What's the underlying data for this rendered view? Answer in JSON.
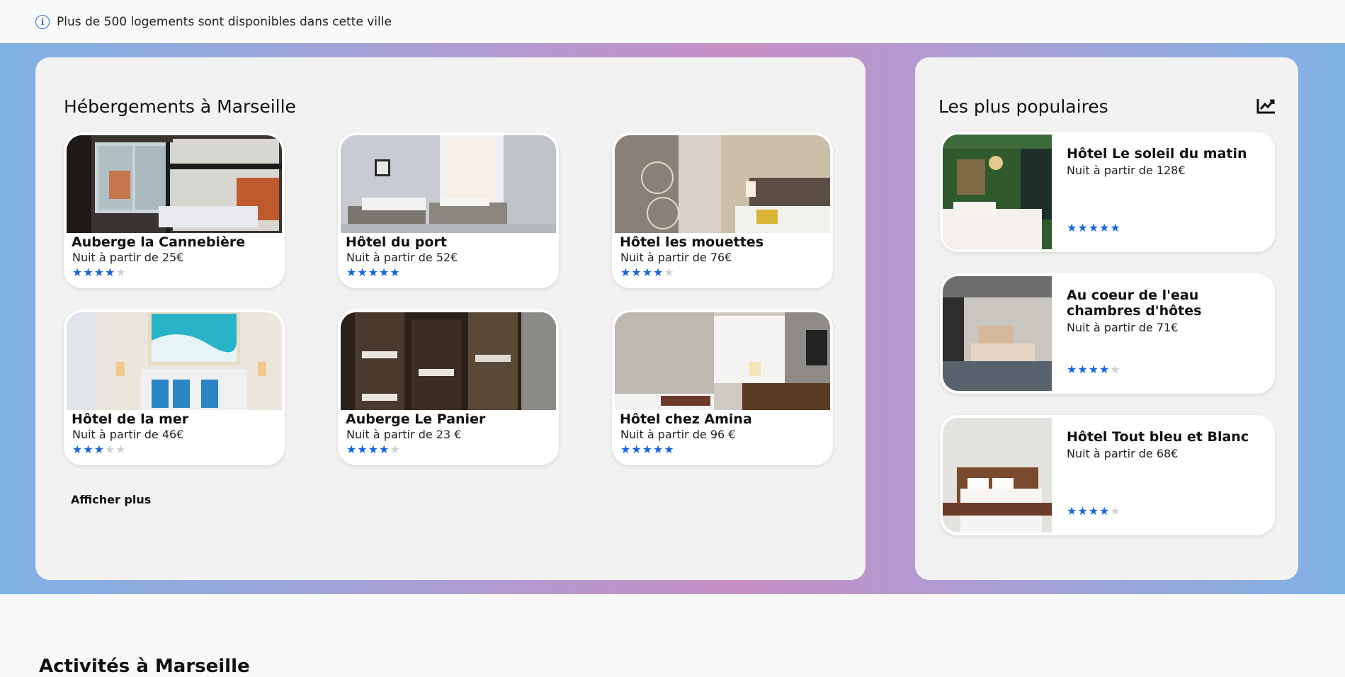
{
  "info": {
    "icon": "info-icon",
    "text": "Plus de 500 logements sont disponibles dans cette ville"
  },
  "main": {
    "title": "Hébergements à Marseille",
    "show_more": "Afficher plus",
    "cards": [
      {
        "name": "Auberge la Cannebière",
        "price": "Nuit à partir de 25€",
        "rating": 4
      },
      {
        "name": "Hôtel du port",
        "price": "Nuit à partir de 52€",
        "rating": 5
      },
      {
        "name": "Hôtel les mouettes",
        "price": "Nuit à partir de 76€",
        "rating": 4
      },
      {
        "name": "Hôtel de la mer",
        "price": "Nuit à partir de 46€",
        "rating": 3
      },
      {
        "name": "Auberge Le Panier",
        "price": "Nuit à partir de 23 €",
        "rating": 4
      },
      {
        "name": "Hôtel chez Amina",
        "price": "Nuit à partir de 96 €",
        "rating": 5
      }
    ]
  },
  "side": {
    "title": "Les plus populaires",
    "icon": "trending-up-icon",
    "items": [
      {
        "name": "Hôtel Le soleil du matin",
        "price": "Nuit à partir de 128€",
        "rating": 5
      },
      {
        "name": "Au coeur de l'eau chambres d'hôtes",
        "price": "Nuit à partir de 71€",
        "rating": 4
      },
      {
        "name": "Hôtel Tout bleu et Blanc",
        "price": "Nuit à partir de 68€",
        "rating": 4
      }
    ]
  },
  "section2": {
    "title": "Activités à Marseille"
  },
  "colors": {
    "star_on": "#1565e0",
    "star_off": "#cfd3d8",
    "panel_bg": "#f2f2f2",
    "accent_blue": "#7fb2e5",
    "accent_pink": "#c78fc5"
  }
}
